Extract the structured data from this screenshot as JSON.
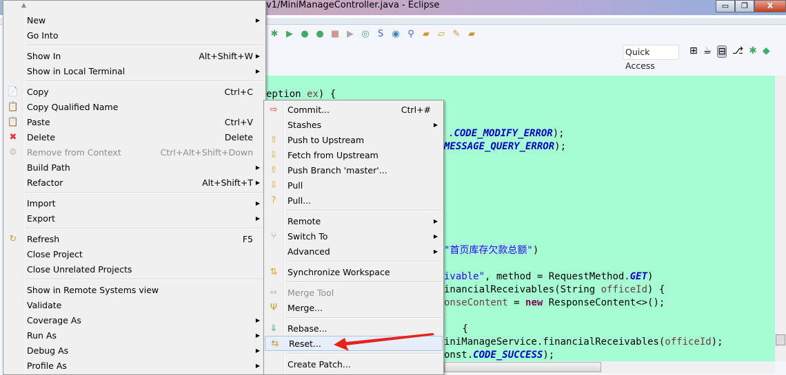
{
  "window": {
    "title": "v1/MiniManageController.java - Eclipse",
    "min": "▭",
    "restore": "❐",
    "close": "X"
  },
  "toolbar": {
    "quick_access": "Quick Access"
  },
  "editor": {
    "lines": [
      {
        "segments": [
          {
            "t": "eption ",
            "c": ""
          },
          {
            "t": "ex",
            "c": "var"
          },
          {
            "t": ") {",
            "c": ""
          }
        ]
      },
      {
        "segments": [
          {
            "t": ".",
            "c": ""
          },
          {
            "t": "CODE_MODIFY_ERROR",
            "c": "const"
          },
          {
            "t": ");",
            "c": ""
          }
        ]
      },
      {
        "segments": [
          {
            "t": "MESSAGE_QUERY_ERROR",
            "c": "const"
          },
          {
            "t": ");",
            "c": ""
          }
        ]
      },
      {
        "segments": [
          {
            "t": "\"首页库存欠款总额\"",
            "c": "str"
          },
          {
            "t": ")",
            "c": ""
          }
        ]
      },
      {
        "segments": [
          {
            "t": "ivable\"",
            "c": "str"
          },
          {
            "t": ", method = RequestMethod.",
            "c": ""
          },
          {
            "t": "GET",
            "c": "const"
          },
          {
            "t": ")",
            "c": ""
          }
        ]
      },
      {
        "segments": [
          {
            "t": "inancialReceivables(String ",
            "c": ""
          },
          {
            "t": "officeId",
            "c": "var"
          },
          {
            "t": ") {",
            "c": ""
          }
        ]
      },
      {
        "segments": [
          {
            "t": "onseContent",
            "c": "var"
          },
          {
            "t": " = ",
            "c": ""
          },
          {
            "t": "new",
            "c": "kw"
          },
          {
            "t": " ResponseContent<>();",
            "c": ""
          }
        ]
      },
      {
        "segments": [
          {
            "t": " {",
            "c": ""
          }
        ]
      },
      {
        "segments": [
          {
            "t": "iniManageService.financialReceivables(",
            "c": ""
          },
          {
            "t": "officeId",
            "c": "var"
          },
          {
            "t": ");",
            "c": ""
          }
        ]
      },
      {
        "segments": [
          {
            "t": "onst.",
            "c": ""
          },
          {
            "t": "CODE_SUCCESS",
            "c": "const"
          },
          {
            "t": ");",
            "c": ""
          }
        ]
      }
    ]
  },
  "context_menu": {
    "items": [
      {
        "label": "New",
        "arrow": true
      },
      {
        "label": "Go Into"
      },
      {
        "sep": true
      },
      {
        "label": "Show In",
        "shortcut": "Alt+Shift+W",
        "arrow": true
      },
      {
        "label": "Show in Local Terminal",
        "arrow": true
      },
      {
        "sep": true
      },
      {
        "label": "Copy",
        "shortcut": "Ctrl+C",
        "icon": "copy-icon",
        "glyph": "📄"
      },
      {
        "label": "Copy Qualified Name",
        "icon": "copy-qualified-icon",
        "glyph": "📋"
      },
      {
        "label": "Paste",
        "shortcut": "Ctrl+V",
        "icon": "paste-icon",
        "glyph": "📋"
      },
      {
        "label": "Delete",
        "shortcut": "Delete",
        "icon": "delete-icon",
        "glyph": "✖"
      },
      {
        "label": "Remove from Context",
        "shortcut": "Ctrl+Alt+Shift+Down",
        "disabled": true,
        "icon": "remove-context-icon",
        "glyph": "⚙"
      },
      {
        "label": "Build Path",
        "arrow": true
      },
      {
        "label": "Refactor",
        "shortcut": "Alt+Shift+T",
        "arrow": true
      },
      {
        "sep": true
      },
      {
        "label": "Import",
        "arrow": true
      },
      {
        "label": "Export",
        "arrow": true
      },
      {
        "sep": true
      },
      {
        "label": "Refresh",
        "shortcut": "F5",
        "icon": "refresh-icon",
        "glyph": "↻"
      },
      {
        "label": "Close Project"
      },
      {
        "label": "Close Unrelated Projects"
      },
      {
        "sep": true
      },
      {
        "label": "Show in Remote Systems view"
      },
      {
        "label": "Validate"
      },
      {
        "label": "Coverage As",
        "arrow": true
      },
      {
        "label": "Run As",
        "arrow": true
      },
      {
        "label": "Debug As",
        "arrow": true
      },
      {
        "label": "Profile As",
        "arrow": true
      }
    ]
  },
  "team_submenu": {
    "items": [
      {
        "label": "Commit...",
        "shortcut": "Ctrl+#",
        "icon": "commit-icon",
        "glyph": "⇨"
      },
      {
        "label": "Stashes",
        "arrow": true
      },
      {
        "label": "Push to Upstream",
        "icon": "push-icon",
        "glyph": "⇧"
      },
      {
        "label": "Fetch from Upstream",
        "icon": "fetch-icon",
        "glyph": "⇩"
      },
      {
        "label": "Push Branch 'master'...",
        "icon": "push-branch-icon",
        "glyph": "⇧"
      },
      {
        "label": "Pull",
        "icon": "pull-icon",
        "glyph": "⇩"
      },
      {
        "label": "Pull...",
        "icon": "pull-dialog-icon",
        "glyph": "?"
      },
      {
        "sep": true
      },
      {
        "label": "Remote",
        "arrow": true
      },
      {
        "label": "Switch To",
        "arrow": true,
        "icon": "switch-icon",
        "glyph": "⑂"
      },
      {
        "label": "Advanced",
        "arrow": true
      },
      {
        "sep": true
      },
      {
        "label": "Synchronize Workspace",
        "icon": "synchronize-icon",
        "glyph": "⇅"
      },
      {
        "sep": true
      },
      {
        "label": "Merge Tool",
        "disabled": true,
        "icon": "merge-tool-icon",
        "glyph": "⇔"
      },
      {
        "label": "Merge...",
        "icon": "merge-icon",
        "glyph": "Ψ"
      },
      {
        "sep": true
      },
      {
        "label": "Rebase...",
        "icon": "rebase-icon",
        "glyph": "⇓"
      },
      {
        "label": "Reset...",
        "icon": "reset-icon",
        "glyph": "⇆",
        "highlighted": true
      },
      {
        "sep": true
      },
      {
        "label": "Create Patch..."
      }
    ]
  },
  "colors": {
    "editor_bg": "#a6fdd3",
    "annotation_arrow": "#e8231c",
    "highlight": "#e6eefa"
  }
}
